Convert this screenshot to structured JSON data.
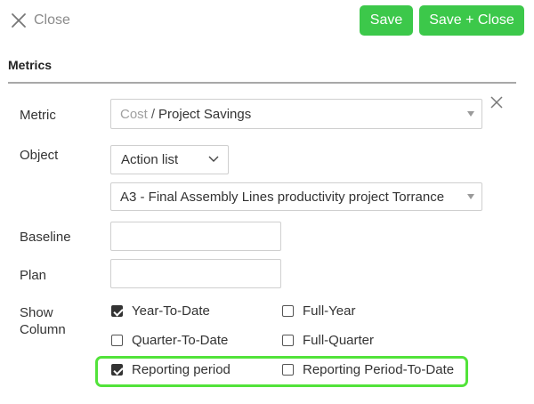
{
  "header": {
    "close_label": "Close",
    "save_label": "Save",
    "save_close_label": "Save + Close",
    "button_color": "#3cc84a"
  },
  "section": {
    "title": "Metrics"
  },
  "form": {
    "metric": {
      "label": "Metric",
      "category": "Cost",
      "separator": "/",
      "value": "Project Savings"
    },
    "object": {
      "label": "Object",
      "type_value": "Action list",
      "item_value": "A3 - Final Assembly Lines productivity project Torrance"
    },
    "baseline": {
      "label": "Baseline",
      "value": ""
    },
    "plan": {
      "label": "Plan",
      "value": ""
    },
    "show_column": {
      "label": "Show Column",
      "options": [
        {
          "label": "Year-To-Date",
          "checked": true
        },
        {
          "label": "Full-Year",
          "checked": false
        },
        {
          "label": "Quarter-To-Date",
          "checked": false
        },
        {
          "label": "Full-Quarter",
          "checked": false
        },
        {
          "label": "Reporting period",
          "checked": true
        },
        {
          "label": "Reporting Period-To-Date",
          "checked": false
        }
      ]
    }
  },
  "highlight_color": "#52e33a"
}
